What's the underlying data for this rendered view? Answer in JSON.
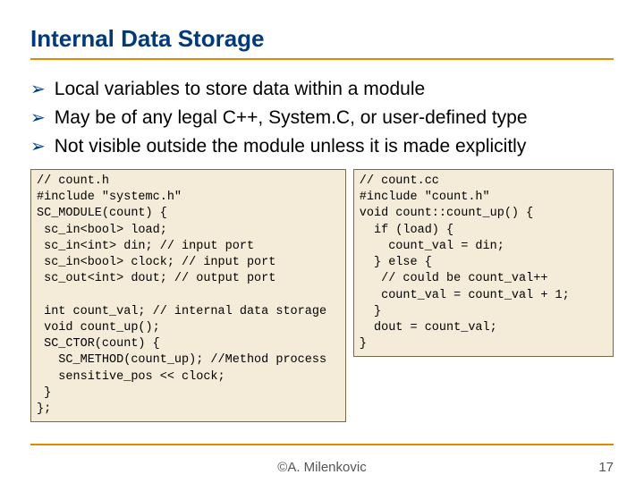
{
  "title": "Internal Data Storage",
  "bullets": [
    "Local variables to store data within a module",
    "May be of any legal C++, System.C, or user-defined type",
    "Not visible outside the module unless it is made explicitly"
  ],
  "code_left": "// count.h\n#include \"systemc.h\"\nSC_MODULE(count) {\n sc_in<bool> load;\n sc_in<int> din; // input port\n sc_in<bool> clock; // input port\n sc_out<int> dout; // output port\n\n int count_val; // internal data storage\n void count_up();\n SC_CTOR(count) {\n   SC_METHOD(count_up); //Method process\n   sensitive_pos << clock;\n }\n};",
  "code_right": "// count.cc\n#include \"count.h\"\nvoid count::count_up() {\n  if (load) {\n    count_val = din;\n  } else {\n   // could be count_val++\n   count_val = count_val + 1;\n  }\n  dout = count_val;\n}",
  "footer": {
    "author": "©A. Milenkovic",
    "page": "17"
  }
}
